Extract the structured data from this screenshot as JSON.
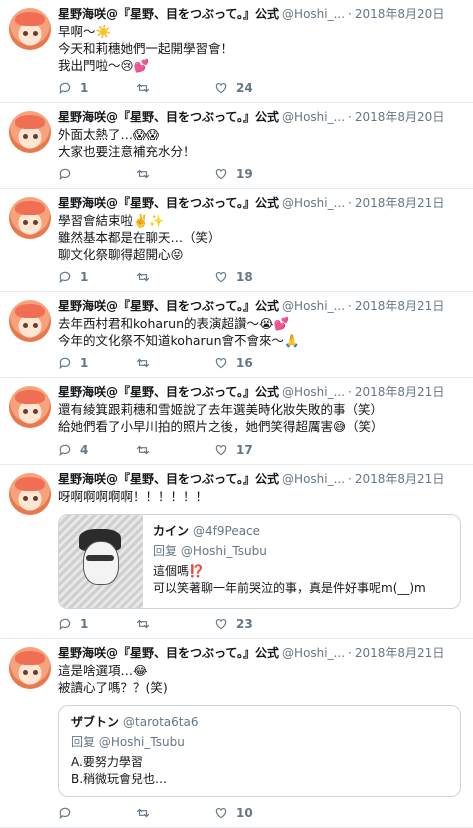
{
  "tweets": [
    {
      "name": "星野海咲@『星野、目をつぶって。』公式",
      "handle": "@Hoshi_...",
      "time": "2018年8月20日",
      "text": "早啊～☀️\n今天和莉穗她們一起開學習會！\n我出門啦～😢💕",
      "replies": "1",
      "retweets": "",
      "likes": "24"
    },
    {
      "name": "星野海咲@『星野、目をつぶって。』公式",
      "handle": "@Hoshi_...",
      "time": "2018年8月20日",
      "text": "外面太熱了…😱😱\n大家也要注意補充水分！",
      "replies": "",
      "retweets": "",
      "likes": "19"
    },
    {
      "name": "星野海咲@『星野、目をつぶって。』公式",
      "handle": "@Hoshi_...",
      "time": "2018年8月21日",
      "text": "學習會結束啦✌️✨\n雖然基本都是在聊天…（笑）\n聊文化祭聊得超開心😝",
      "replies": "1",
      "retweets": "",
      "likes": "18"
    },
    {
      "name": "星野海咲@『星野、目をつぶって。』公式",
      "handle": "@Hoshi_...",
      "time": "2018年8月21日",
      "text": "去年西村君和koharun的表演超讚～😭💕\n今年的文化祭不知道koharun會不會來～🙏",
      "replies": "1",
      "retweets": "",
      "likes": "16"
    },
    {
      "name": "星野海咲@『星野、目をつぶって。』公式",
      "handle": "@Hoshi_...",
      "time": "2018年8月21日",
      "text": "還有綾箕跟莉穗和雪姬說了去年選美時化妝失敗的事（笑）\n給她們看了小早川拍的照片之後，她們笑得超厲害😅（笑）",
      "replies": "4",
      "retweets": "",
      "likes": "17"
    },
    {
      "name": "星野海咲@『星野、目をつぶって。』公式",
      "handle": "@Hoshi_...",
      "time": "2018年8月21日",
      "text": "呀啊啊啊啊啊！！！！！！",
      "replies": "1",
      "retweets": "",
      "likes": "23",
      "quote": {
        "name": "カイン",
        "handle": "@4f9Peace",
        "reply": "回复 @Hoshi_Tsubu",
        "text": "這個嗎⁉️\n可以笑著聊一年前哭泣的事，真是件好事呢m(__)m"
      }
    },
    {
      "name": "星野海咲@『星野、目をつぶって。』公式",
      "handle": "@Hoshi_...",
      "time": "2018年8月21日",
      "text": "這是啥選項…😂\n被讀心了嗎？？(笑)",
      "replies": "",
      "retweets": "",
      "likes": "10",
      "quote": {
        "name": "ザブトン",
        "handle": "@tarota6ta6",
        "reply": "回复 @Hoshi_Tsubu",
        "text": "A.要努力學習\nB.稍微玩會兒也…"
      }
    }
  ]
}
